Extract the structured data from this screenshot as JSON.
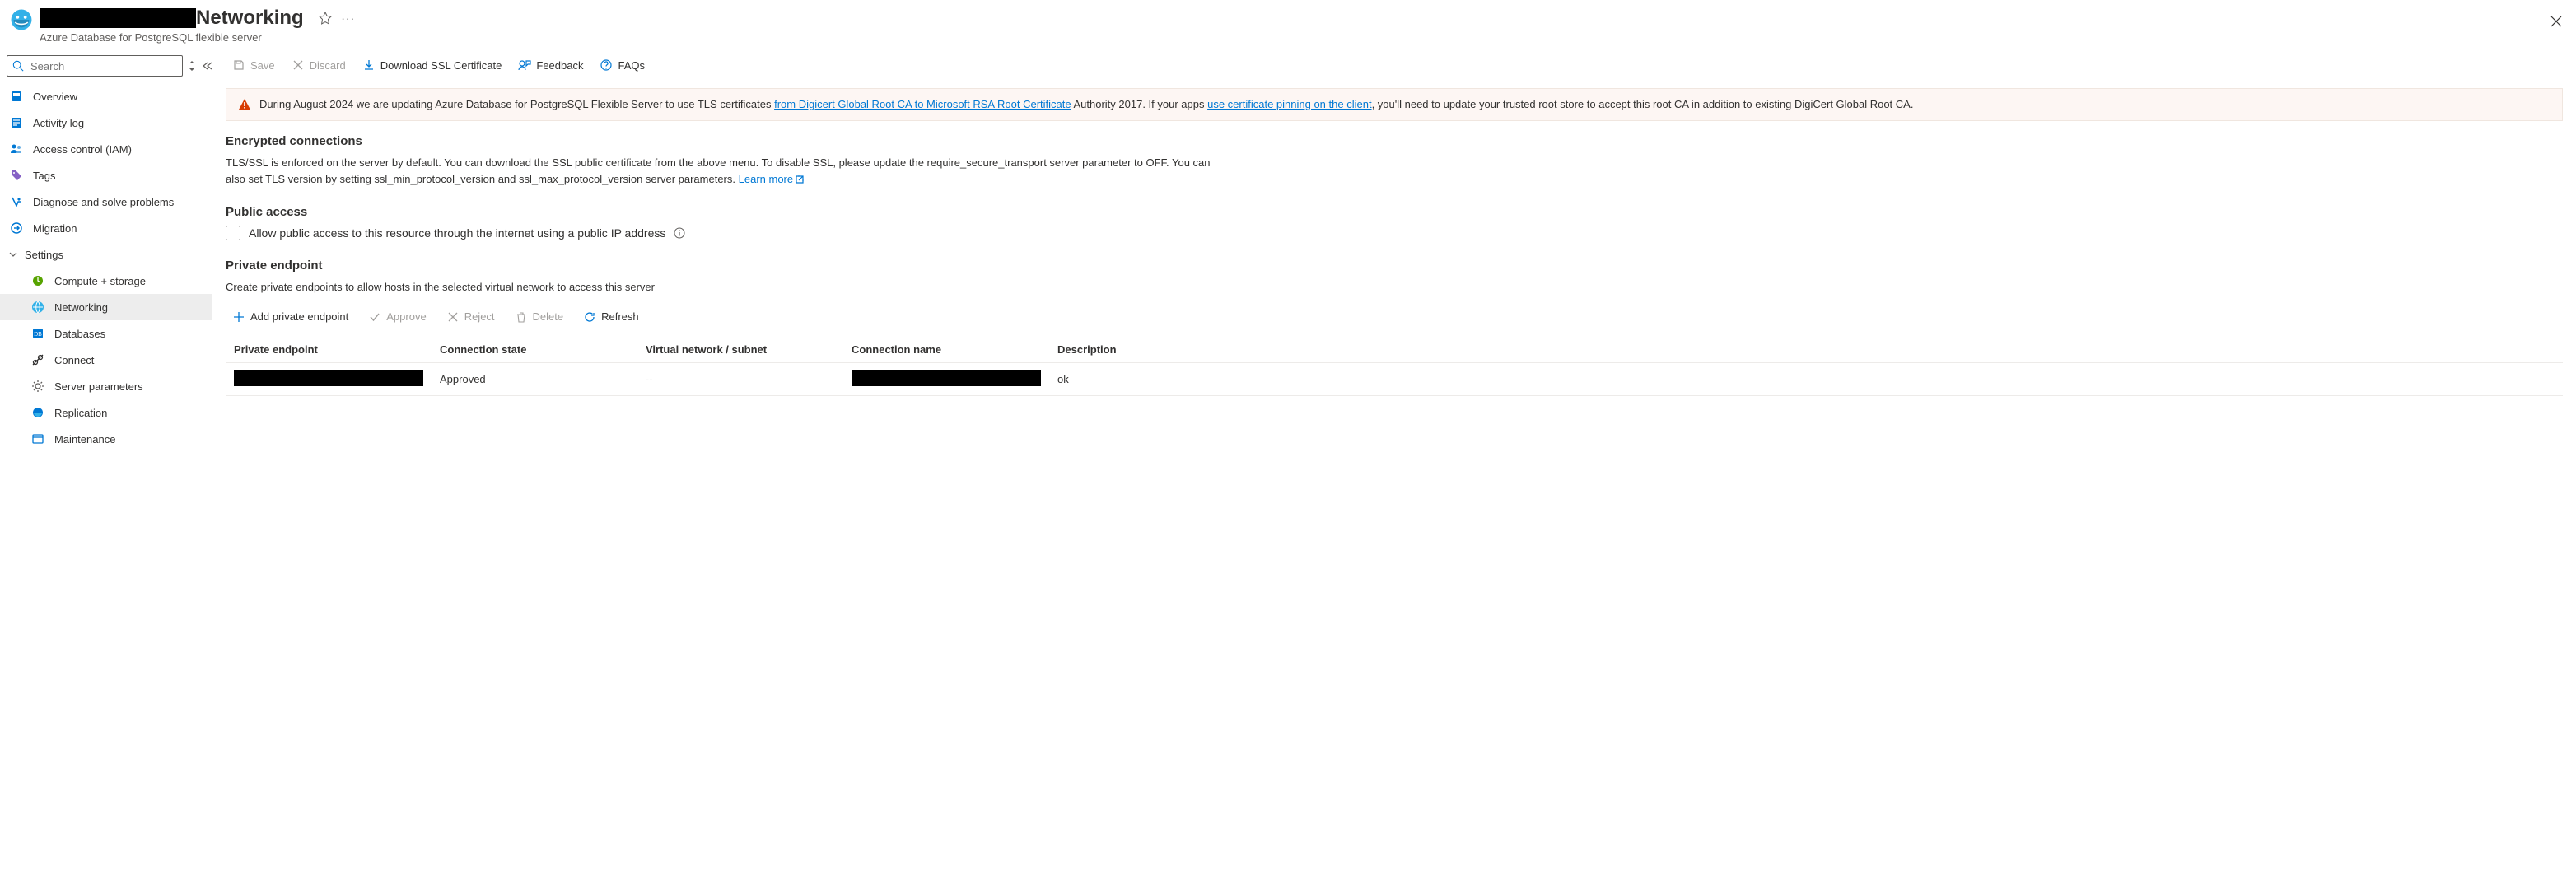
{
  "header": {
    "title_suffix": "Networking",
    "subtitle": "Azure Database for PostgreSQL flexible server"
  },
  "search": {
    "placeholder": "Search"
  },
  "nav": {
    "overview": "Overview",
    "activity_log": "Activity log",
    "access_control": "Access control (IAM)",
    "tags": "Tags",
    "diagnose": "Diagnose and solve problems",
    "migration": "Migration",
    "settings_group": "Settings",
    "compute_storage": "Compute + storage",
    "networking": "Networking",
    "databases": "Databases",
    "connect": "Connect",
    "server_parameters": "Server parameters",
    "replication": "Replication",
    "maintenance": "Maintenance"
  },
  "toolbar": {
    "save": "Save",
    "discard": "Discard",
    "download_ssl": "Download SSL Certificate",
    "feedback": "Feedback",
    "faqs": "FAQs"
  },
  "alert": {
    "part1": "During August 2024 we are updating Azure Database for PostgreSQL Flexible Server to use TLS certificates ",
    "link1": "from Digicert Global Root CA to Microsoft RSA Root Certificate",
    "part2": " Authority 2017. If your apps ",
    "link2": "use certificate pinning on the client",
    "part3": ", you'll need to update your trusted root store to accept this root CA in addition to existing DigiCert Global Root CA."
  },
  "encrypted": {
    "title": "Encrypted connections",
    "body": "TLS/SSL is enforced on the server by default. You can download the SSL public certificate from the above menu. To disable SSL, please update the require_secure_transport server parameter to OFF. You can also set TLS version by setting ssl_min_protocol_version and ssl_max_protocol_version server parameters. ",
    "learn_more": "Learn more"
  },
  "public_access": {
    "title": "Public access",
    "label": "Allow public access to this resource through the internet using a public IP address"
  },
  "private_endpoint": {
    "title": "Private endpoint",
    "desc": "Create private endpoints to allow hosts in the selected virtual network to access this server",
    "add": "Add private endpoint",
    "approve": "Approve",
    "reject": "Reject",
    "delete": "Delete",
    "refresh": "Refresh",
    "columns": {
      "private_endpoint": "Private endpoint",
      "connection_state": "Connection state",
      "vnet_subnet": "Virtual network / subnet",
      "connection_name": "Connection name",
      "description": "Description"
    },
    "row": {
      "connection_state": "Approved",
      "vnet_subnet": "--",
      "description": "ok"
    }
  }
}
